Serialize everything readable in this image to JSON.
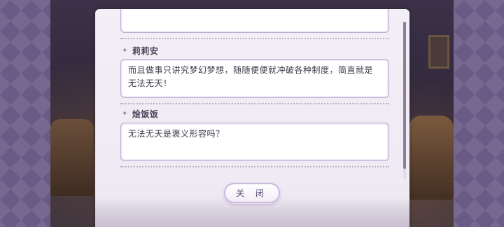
{
  "dialog_log": {
    "entries": [
      {
        "speaker": "",
        "text": ""
      },
      {
        "speaker": "莉莉安",
        "text": "而且做事只讲究梦幻梦想，随随便便就冲破各种制度，简直就是无法无天！"
      },
      {
        "speaker": "烩饭饭",
        "text": "无法无天是褒义形容吗？"
      }
    ],
    "close_label": "关 闭"
  },
  "colors": {
    "panel_bg": "#f3eff6",
    "textbox_border": "#b7a8d0",
    "speaker_text": "#4a4058",
    "side_lattice": "#6a5b86"
  },
  "icons": {
    "speaker_marker": "sparkle-icon"
  }
}
